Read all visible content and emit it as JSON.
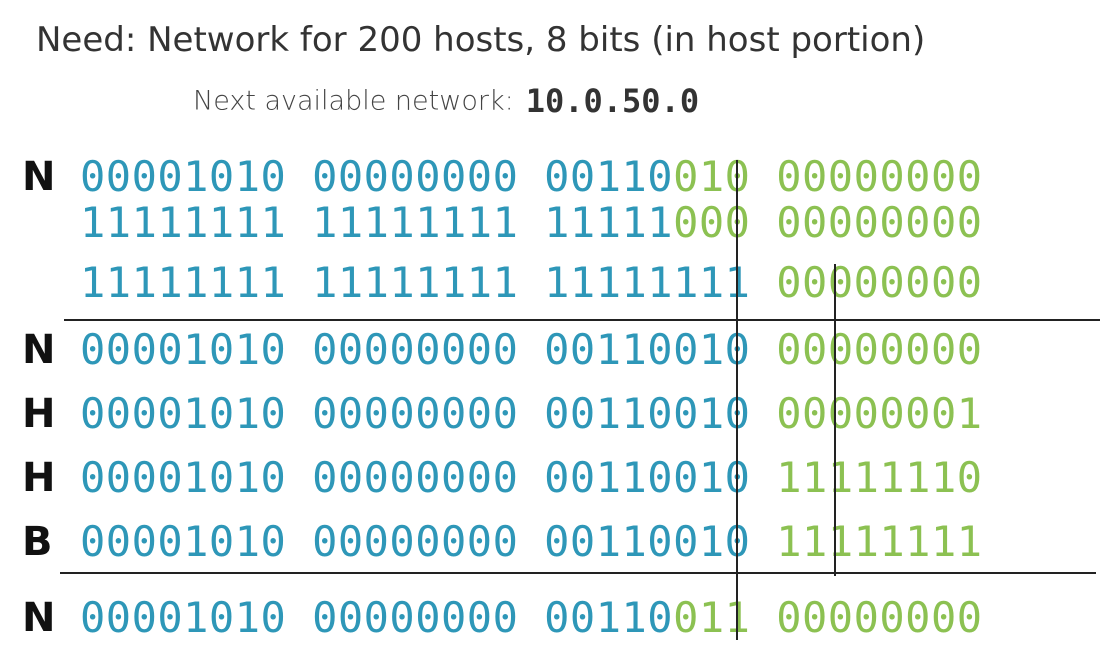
{
  "heading": "Need: Network for 200 hosts, 8 bits (in host portion)",
  "subheading": {
    "label": "Next available network:",
    "address": "10.0.50.0"
  },
  "colors": {
    "network_bits": "#2e97b8",
    "host_bits": "#8cc152",
    "lines": "#222222"
  },
  "rows": [
    {
      "label": "N",
      "net": "00001010 00000000 00110",
      "host": "010 00000000"
    },
    {
      "label": "",
      "net": "11111111 11111111 11111",
      "host": "000 00000000"
    },
    {
      "label": "",
      "net": "11111111 11111111 11111111",
      "host": "00000000"
    },
    {
      "label": "N",
      "net": "00001010 00000000 00110010",
      "host": "00000000"
    },
    {
      "label": "H",
      "net": "00001010 00000000 00110010",
      "host": "00000001"
    },
    {
      "label": "H",
      "net": "00001010 00000000 00110010",
      "host": "11111110"
    },
    {
      "label": "B",
      "net": "00001010 00000000 00110010",
      "host": "11111111"
    },
    {
      "label": "N",
      "net": "00001010 00000000 00110",
      "host": "011 00000000"
    }
  ]
}
